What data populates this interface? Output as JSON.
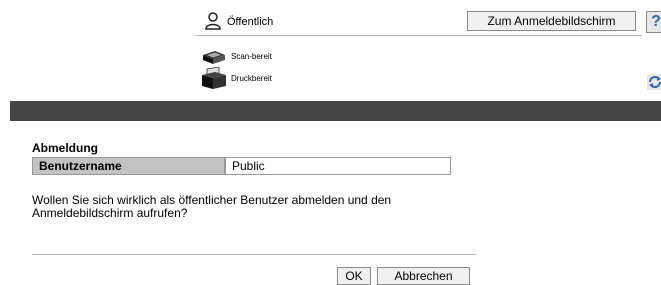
{
  "header": {
    "user_label": "Öffentlich",
    "login_screen_button": "Zum Anmeldebildschirm",
    "help_button": "?"
  },
  "status": {
    "scan": "Scan-bereit",
    "print": "Druckbereit"
  },
  "icons": {
    "user": "user-icon",
    "scanner": "scanner-icon",
    "printer": "printer-icon",
    "refresh": "refresh-icon",
    "help": "help-icon"
  },
  "logout": {
    "title": "Abmeldung",
    "field_label": "Benutzername",
    "field_value": "Public",
    "question": "Wollen Sie sich wirklich als öffentlicher Benutzer abmelden und den Anmeldebildschirm aufrufen?",
    "ok_button": "OK",
    "cancel_button": "Abbrechen"
  },
  "colors": {
    "band": "#454545",
    "label_bg": "#c2c2c2",
    "help_accent": "#2a66c0",
    "refresh_accent": "#2a66c0"
  }
}
